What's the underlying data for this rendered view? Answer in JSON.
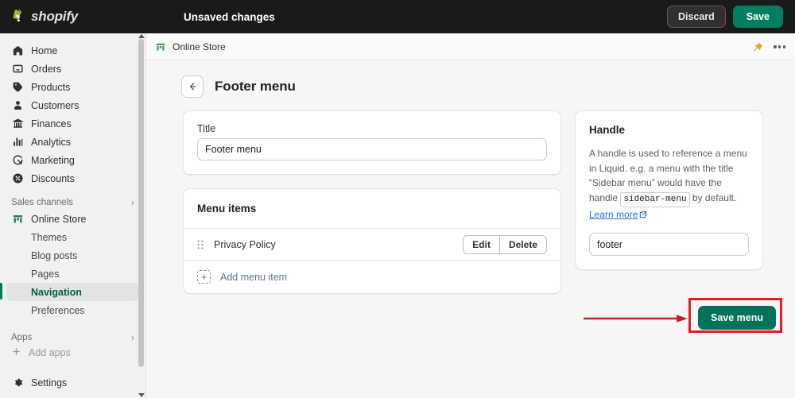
{
  "topbar": {
    "brand": "shopify",
    "brand_logo_icon": "shopify-bag-icon",
    "status": "Unsaved changes",
    "discard_label": "Discard",
    "save_label": "Save"
  },
  "sidebar": {
    "primary": [
      {
        "label": "Home",
        "icon": "home-icon"
      },
      {
        "label": "Orders",
        "icon": "orders-inbox-icon"
      },
      {
        "label": "Products",
        "icon": "product-tag-icon"
      },
      {
        "label": "Customers",
        "icon": "customer-person-icon"
      },
      {
        "label": "Finances",
        "icon": "finances-bank-icon"
      },
      {
        "label": "Analytics",
        "icon": "analytics-bars-icon"
      },
      {
        "label": "Marketing",
        "icon": "marketing-megaphone-icon"
      },
      {
        "label": "Discounts",
        "icon": "discount-tag-icon"
      }
    ],
    "sales_channels_label": "Sales channels",
    "sales_channels_chevron": "chevron-right-icon",
    "online_store": {
      "label": "Online Store",
      "icon": "storefront-icon"
    },
    "online_store_children": [
      {
        "label": "Themes",
        "active": false
      },
      {
        "label": "Blog posts",
        "active": false
      },
      {
        "label": "Pages",
        "active": false
      },
      {
        "label": "Navigation",
        "active": true
      },
      {
        "label": "Preferences",
        "active": false
      }
    ],
    "apps_label": "Apps",
    "apps_chevron": "chevron-right-icon",
    "add_apps_label": "Add apps",
    "add_apps_icon": "plus-icon",
    "settings": {
      "label": "Settings",
      "icon": "gear-icon"
    }
  },
  "breadcrumb": {
    "label": "Online Store",
    "icon": "storefront-icon",
    "pin_icon": "pin-icon",
    "more_icon": "ellipsis-icon"
  },
  "page": {
    "back_icon": "arrow-left-icon",
    "title": "Footer menu"
  },
  "title_card": {
    "label": "Title",
    "value": "Footer menu",
    "placeholder": "Title"
  },
  "menu_items_card": {
    "heading": "Menu items",
    "drag_icon": "drag-handle-icon",
    "items": [
      {
        "label": "Privacy Policy",
        "edit_label": "Edit",
        "delete_label": "Delete"
      }
    ],
    "add_label": "Add menu item",
    "add_icon": "add-square-icon"
  },
  "handle_card": {
    "heading": "Handle",
    "description_part1": "A handle is used to reference a menu in Liquid. e.g. a menu with the title “Sidebar menu” would have the handle ",
    "code_sample": "sidebar-menu",
    "description_part2": " by default. ",
    "learn_more_label": "Learn more",
    "external_icon": "external-link-icon",
    "value": "footer",
    "placeholder": "Handle"
  },
  "save_menu": {
    "label": "Save menu",
    "highlight_color": "#e02020",
    "arrow_color": "#c92020",
    "button_color": "#00735a"
  },
  "colors": {
    "topbar_bg": "#1a1a1a",
    "sidebar_bg": "#f1f1f1",
    "main_bg": "#f6f6f7",
    "card_bg": "#ffffff",
    "brand_green": "#008060",
    "active_green": "#005c43",
    "link_blue": "#2c6ecb"
  }
}
